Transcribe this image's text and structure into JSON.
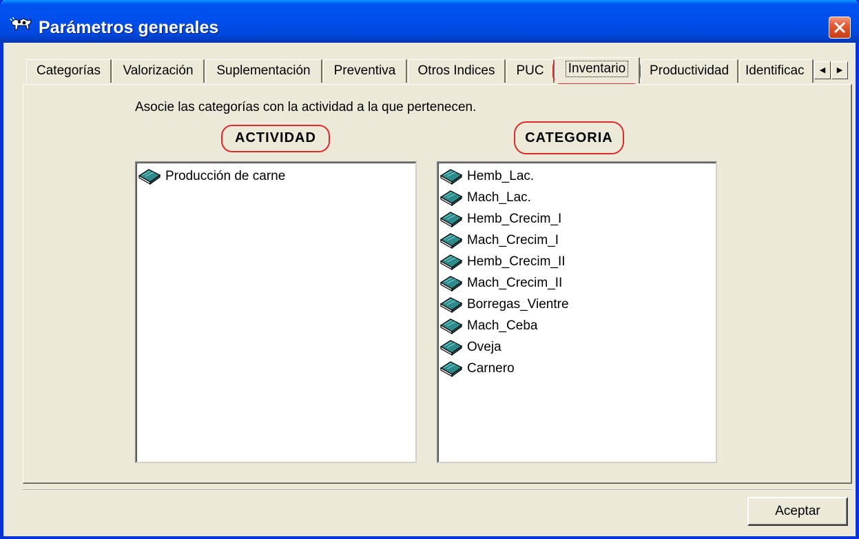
{
  "window": {
    "title": "Parámetros generales"
  },
  "tabs": [
    {
      "label": "Categorías"
    },
    {
      "label": "Valorización"
    },
    {
      "label": "Suplementación"
    },
    {
      "label": "Preventiva"
    },
    {
      "label": "Otros Indices"
    },
    {
      "label": "PUC"
    },
    {
      "label": "Inventario",
      "active": true
    },
    {
      "label": "Productividad"
    },
    {
      "label": "Identificac"
    }
  ],
  "panel": {
    "instruction": "Asocie las categorías con la actividad a la que pertenecen.",
    "actividad_header": "ACTIVIDAD",
    "categoria_header": "CATEGORIA",
    "actividades": [
      "Producción de carne"
    ],
    "categorias": [
      "Hemb_Lac.",
      "Mach_Lac.",
      "Hemb_Crecim_I",
      "Mach_Crecim_I",
      "Hemb_Crecim_II",
      "Mach_Crecim_II",
      "Borregas_Vientre",
      "Mach_Ceba",
      "Oveja",
      "Carnero"
    ]
  },
  "buttons": {
    "accept": "Aceptar"
  },
  "icons": {
    "app": "cow-icon",
    "close": "close-icon",
    "list_item": "book-icon",
    "scroll_left": "arrow-left-icon",
    "scroll_right": "arrow-right-icon"
  },
  "colors": {
    "titlebar": "#0050ee",
    "window_bg": "#ece9d8",
    "highlight": "#e0282a",
    "book": "#2e7d7d"
  }
}
